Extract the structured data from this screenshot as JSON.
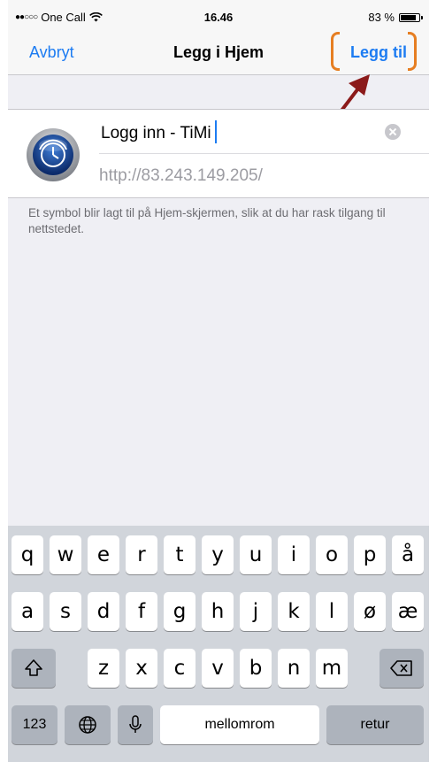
{
  "status_bar": {
    "carrier": "One Call",
    "time": "16.46",
    "battery_percent_text": "83 %",
    "battery_level": 0.83
  },
  "nav": {
    "cancel_label": "Avbryt",
    "title": "Legg i Hjem",
    "add_label": "Legg til"
  },
  "form": {
    "name_value": "Logg inn - TiMi",
    "url": "http://83.243.149.205/",
    "description": "Et symbol blir lagt til på Hjem-skjermen, slik at du har rask tilgang til nettstedet."
  },
  "keyboard": {
    "row1": [
      "q",
      "w",
      "e",
      "r",
      "t",
      "y",
      "u",
      "i",
      "o",
      "p",
      "å"
    ],
    "row2": [
      "a",
      "s",
      "d",
      "f",
      "g",
      "h",
      "j",
      "k",
      "l",
      "ø",
      "æ"
    ],
    "row3": [
      "z",
      "x",
      "c",
      "v",
      "b",
      "n",
      "m"
    ],
    "numbers_label": "123",
    "space_label": "mellomrom",
    "return_label": "retur"
  },
  "colors": {
    "accent": "#1d7cf2",
    "highlight": "#e67e22",
    "arrow": "#8b1a1a"
  }
}
